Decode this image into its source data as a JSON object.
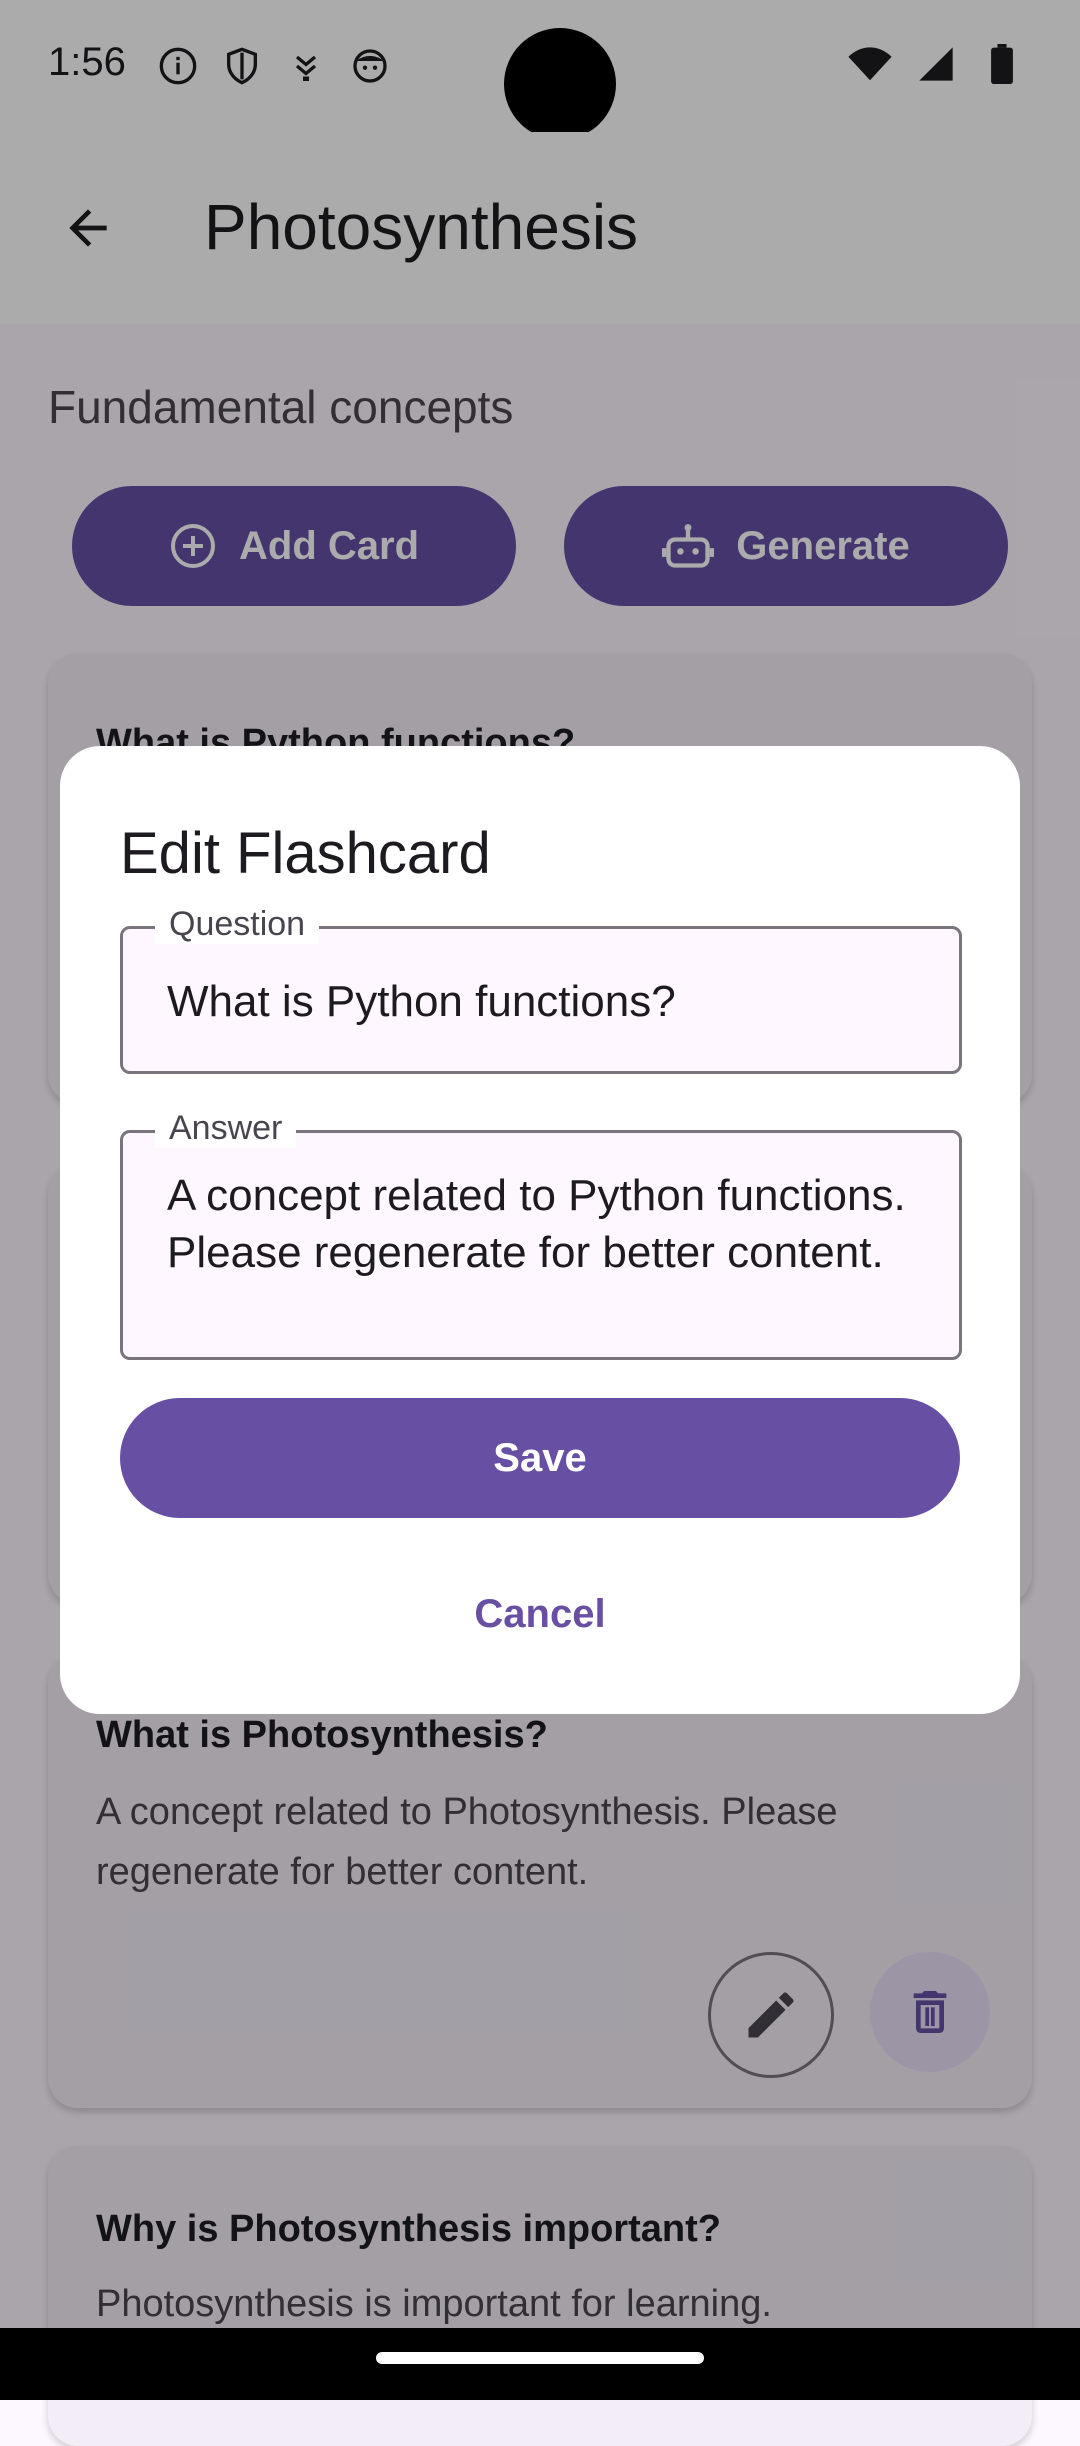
{
  "status_bar": {
    "time": "1:56"
  },
  "app_bar": {
    "title": "Photosynthesis"
  },
  "deck": {
    "subtitle": "Fundamental concepts",
    "add_card_label": "Add Card",
    "generate_label": "Generate"
  },
  "cards": [
    {
      "question": "What is Python functions?",
      "answer": ""
    },
    {
      "question": "What is Photosynthesis?",
      "answer": "A concept related to Photosynthesis. Please regenerate for better content."
    },
    {
      "question": "Why is Photosynthesis important?",
      "answer": "Photosynthesis is important for learning."
    }
  ],
  "dialog": {
    "title": "Edit Flashcard",
    "question_label": "Question",
    "question_value": "What is Python functions?",
    "answer_label": "Answer",
    "answer_value": "A concept related to Python functions. Please regenerate for better content.",
    "save_label": "Save",
    "cancel_label": "Cancel"
  },
  "colors": {
    "primary": "#6750a4",
    "surface": "#fdf7ff",
    "card": "#f3edf7",
    "error_container": "#e8def8"
  },
  "icons": [
    "info-icon",
    "shield-icon",
    "download-icon",
    "face-icon",
    "wifi-icon",
    "signal-icon",
    "battery-icon",
    "back-arrow-icon",
    "add-circle-icon",
    "robot-icon",
    "edit-icon",
    "delete-icon"
  ]
}
